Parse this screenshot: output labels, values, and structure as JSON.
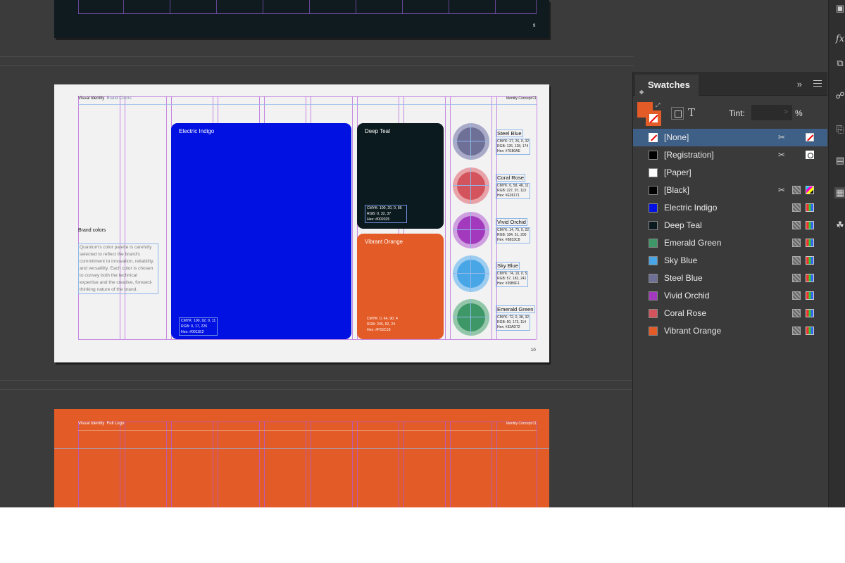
{
  "page9": {
    "page_number": "9"
  },
  "page10": {
    "header_left": "Visual Identity",
    "header_section": "Brand Colors",
    "header_right": "Identity Concept 01",
    "page_number": "10",
    "section_title": "Brand colors",
    "section_description": "Quantum's color palette is carefully selected to reflect the brand's commitment to innovation, reliability, and versatility. Each color is chosen to convey both the technical expertise and the creative, forward-thinking nature of the brand.",
    "cards": [
      {
        "name": "Electric Indigo",
        "color": "#0011E2",
        "cmyk": "CMYK: 100, 92, 0, 11",
        "rgb": "RGB: 0, 17, 226",
        "hex": "Hex: #0011E2"
      },
      {
        "name": "Deep Teal",
        "color": "#0B1A1E",
        "cmyk": "CMYK: 100, 20, 0, 85",
        "rgb": "RGB: 0, 32, 37",
        "hex": "Hex: #002025"
      },
      {
        "name": "Vibrant Orange",
        "color": "#E35B26",
        "cmyk": "CMYK: 0, 64, 90, 4",
        "rgb": "RGB: 245, 92, 24",
        "hex": "Hex: #F55C18"
      }
    ],
    "circles": [
      {
        "name": "Steel Blue",
        "color": "#6E7097",
        "ring": "#a8aac7",
        "cmyk": "CMYK: 27, 26, 0, 32",
        "rgb": "RGB: 126, 128, 174",
        "hex": "Hex: #7E80AE"
      },
      {
        "name": "Coral Rose",
        "color": "#D4545E",
        "ring": "#e8a3a9",
        "cmyk": "CMYK: 0, 58, 48, 11",
        "rgb": "RGB: 227, 97, 113",
        "hex": "Hex: #E36171"
      },
      {
        "name": "Vivid Orchid",
        "color": "#A33ABE",
        "ring": "#cfa0e0",
        "cmyk": "CMYK: 14, 75, 0, 22",
        "rgb": "RGB: 184, 51, 200",
        "hex": "Hex: #B833C8"
      },
      {
        "name": "Sky Blue",
        "color": "#48A6E6",
        "ring": "#9ccdf1",
        "cmyk": "CMYK: 74, 10, 0, 5",
        "rgb": "RGB: 57, 182, 241",
        "hex": "Hex: #39B6F1"
      },
      {
        "name": "Emerald Green",
        "color": "#3E9767",
        "ring": "#94c7aa",
        "cmyk": "CMYK: 72, 0, 38, 32",
        "rgb": "RGB: 50, 173, 114",
        "hex": "Hex: #32AD72"
      }
    ]
  },
  "page11": {
    "header_left": "Visual Identity",
    "header_section": "Full Logo",
    "header_right": "Identity Concept 01"
  },
  "swatches_panel": {
    "title": "Swatches",
    "tint_label": "Tint:",
    "tint_value": "",
    "tint_unit": "%",
    "items": [
      {
        "name": "[None]",
        "color": "none",
        "selected": true
      },
      {
        "name": "[Registration]",
        "color": "#000000"
      },
      {
        "name": "[Paper]",
        "color": "#ffffff"
      },
      {
        "name": "[Black]",
        "color": "#000000"
      },
      {
        "name": "Electric Indigo",
        "color": "#0011E2"
      },
      {
        "name": "Deep Teal",
        "color": "#0B1A1E"
      },
      {
        "name": "Emerald Green",
        "color": "#3E9767"
      },
      {
        "name": "Sky Blue",
        "color": "#48A6E6"
      },
      {
        "name": "Steel Blue",
        "color": "#6E7097"
      },
      {
        "name": "Vivid Orchid",
        "color": "#A33ABE"
      },
      {
        "name": "Coral Rose",
        "color": "#D4545E"
      },
      {
        "name": "Vibrant Orange",
        "color": "#E35B26"
      }
    ]
  }
}
